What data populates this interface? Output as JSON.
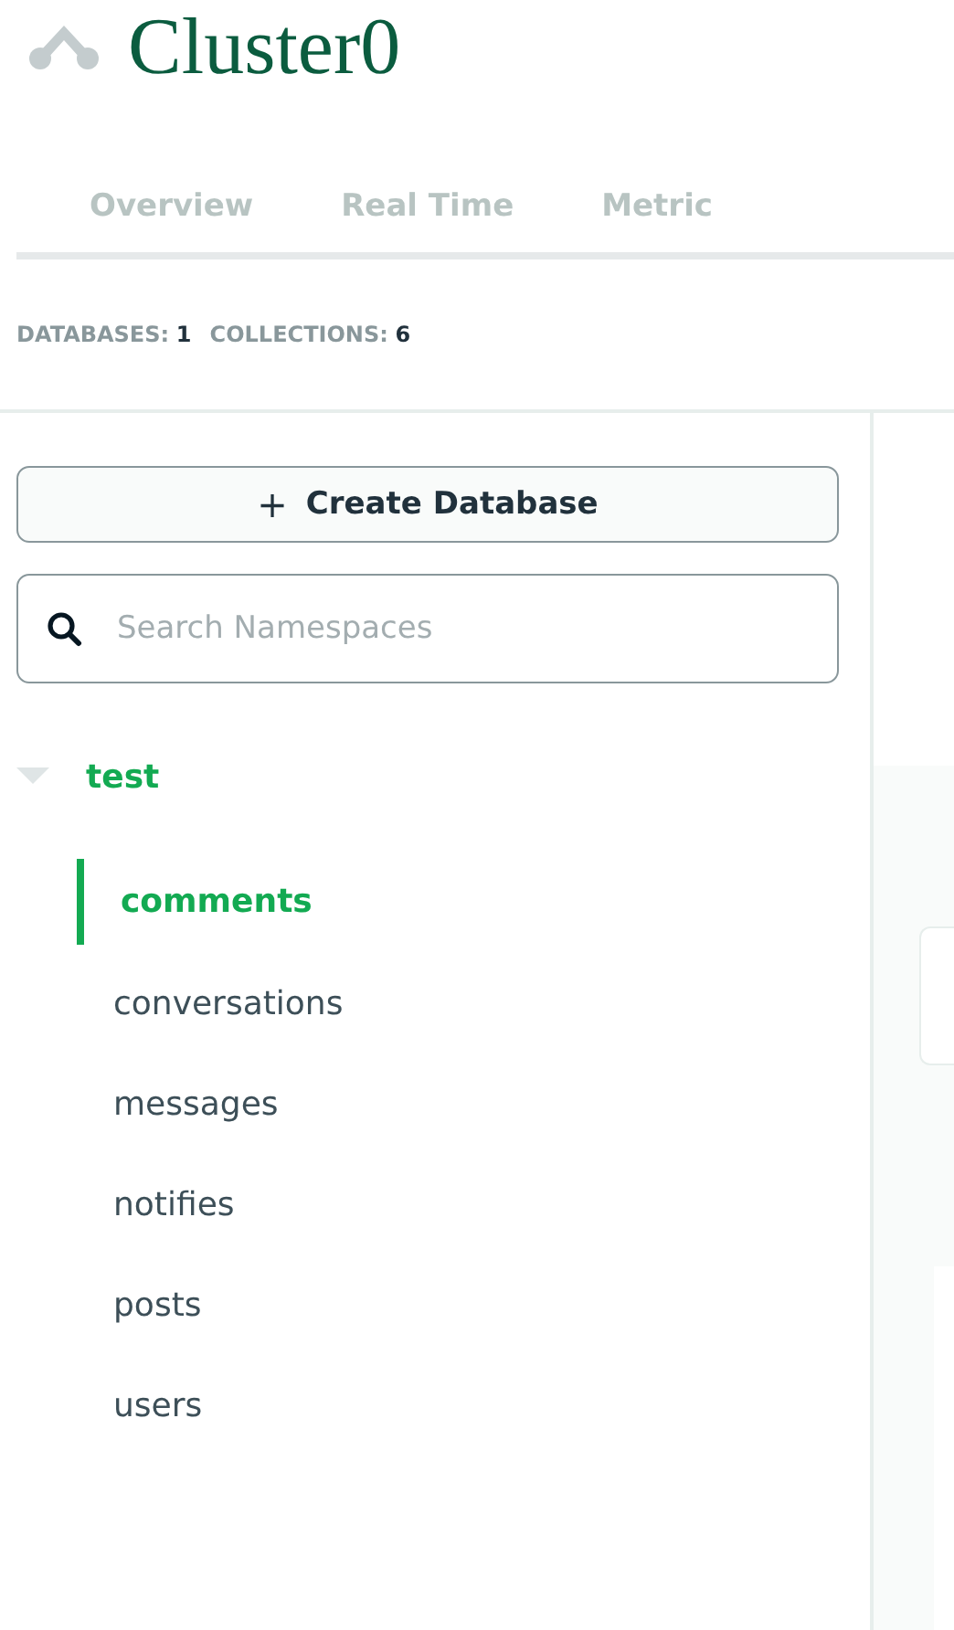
{
  "title": "Cluster0",
  "tabs": [
    {
      "label": "Overview",
      "selected": false
    },
    {
      "label": "Real Time",
      "selected": false
    },
    {
      "label": "Metric",
      "selected": false
    }
  ],
  "stats": [
    {
      "label": "DATABASES:",
      "value": "1"
    },
    {
      "label": "COLLECTIONS:",
      "value": "6"
    }
  ],
  "create_button": {
    "icon": "+",
    "label": "Create Database"
  },
  "search": {
    "placeholder": "Search Namespaces"
  },
  "tree": [
    {
      "name": "test",
      "expanded": true,
      "children": [
        {
          "name": "comments",
          "selected": true
        },
        {
          "name": "conversations",
          "selected": false
        },
        {
          "name": "messages",
          "selected": false
        },
        {
          "name": "notifies",
          "selected": false
        },
        {
          "name": "posts",
          "selected": false
        },
        {
          "name": "users",
          "selected": false
        }
      ]
    }
  ]
}
